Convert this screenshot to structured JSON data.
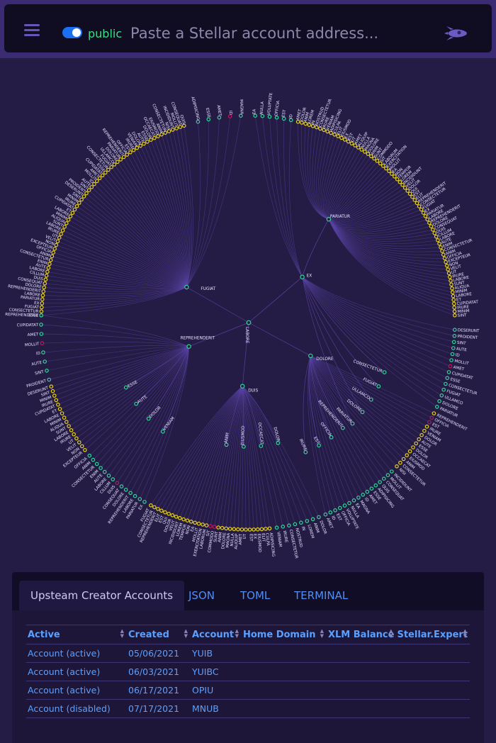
{
  "header": {
    "network_label": "public",
    "search_placeholder": "Paste a Stellar account address...",
    "network_toggle_on": true
  },
  "graph": {
    "root": "LABORE",
    "hubs": [
      "FUGIAT",
      "EX",
      "REPREHENDERIT",
      "DOLORE",
      "DUIS",
      "PARIATUR"
    ],
    "labels": [
      "REPREHENDERIT",
      "CONSECTETUR",
      "FUGIAT",
      "EX",
      "PARIATUR",
      "LABORE",
      "REPREHENDERIT",
      "DOLORE",
      "CONSEQUAT",
      "DUIS",
      "CILLUM",
      "LABORE",
      "AUTE",
      "ENIM",
      "CONSECTETUR",
      "ANIM",
      "OFFICIA",
      "EXCEPTEUR",
      "NON",
      "VELIT",
      "UT",
      "IRURE",
      "LABORE",
      "SUNT",
      "ALIQUA",
      "MINIM",
      "LABORE",
      "ET",
      "CUPIDATAT",
      "IRURE",
      "MINIM",
      "SINT",
      "DESERUNT",
      "PROIDENT",
      "SINT",
      "AUTE",
      "ID",
      "MOLLIT",
      "AMET",
      "CUPIDATAT",
      "ESSE",
      "CONSECTETUR",
      "FUGIAT",
      "ULLAMCO",
      "DOLORE",
      "PARIATUR",
      "REPREHENDERIT",
      "OFFICIA",
      "EST",
      "IRURE",
      "VENIAM",
      "DOLOR",
      "AUTE",
      "ESSE",
      "DOLOR",
      "OCCAECAT",
      "EIUSMOD",
      "ANIM",
      "CONSECTETUR",
      "NISI",
      "INCIDIDUNT",
      "MOLLIT",
      "CONSEQUAT",
      "QUIS",
      "ADIPISICING",
      "ESSE",
      "AMET",
      "ID",
      "MAGNA",
      "EA",
      "NULLA",
      "VOLUPTATE",
      "OFFICIA",
      "EST",
      "ID",
      "AMET",
      "DOLOR",
      "ANIM",
      "LOREM",
      "IN",
      "NOSTRUD",
      "CONSECTETUR",
      "IRURE",
      "VENIAM",
      "ADIPISICING",
      "CULPA",
      "ELIT",
      "EIUSMOD",
      "EX",
      "EST",
      "UT",
      "AMET",
      "ALIQUIP",
      "NULLA",
      "MAGNA",
      "DOLORE",
      "ANIM",
      "SUNT",
      "COMMODO",
      "SIT",
      "LABORUM",
      "EXERCITATION",
      "MOLLIT",
      "EA",
      "NON",
      "TEMPOR",
      "LOREM",
      "INCIDIDUNT",
      "VELIT",
      "DOLOR",
      "QUI",
      "EST",
      "ELIT"
    ]
  },
  "tabs": [
    {
      "label": "Upsteam Creator Accounts"
    },
    {
      "label": "JSON"
    },
    {
      "label": "TOML"
    },
    {
      "label": "TERMINAL"
    }
  ],
  "table": {
    "columns": [
      "Active",
      "Created",
      "Account",
      "Home Domain",
      "XLM Balance",
      "Stellar.Expert"
    ],
    "rows": [
      [
        "Account (active)",
        "05/06/2021",
        "YUIB",
        "",
        "",
        ""
      ],
      [
        "Account (active)",
        "06/03/2021",
        "YUIBC",
        "",
        "",
        ""
      ],
      [
        "Account (active)",
        "06/17/2021",
        "OPIU",
        "",
        "",
        ""
      ],
      [
        "Account (disabled)",
        "07/17/2021",
        "MNUB",
        "",
        "",
        ""
      ]
    ]
  },
  "colors": {
    "header_bg": "#100c22",
    "frame": "#3b2b73",
    "background": "#251c45",
    "leaf_yellow": "#e8d21a",
    "leaf_green": "#31d69a",
    "leaf_red": "#c2185b",
    "link_accent": "#4f8ff5",
    "network_green": "#3ddc84"
  }
}
